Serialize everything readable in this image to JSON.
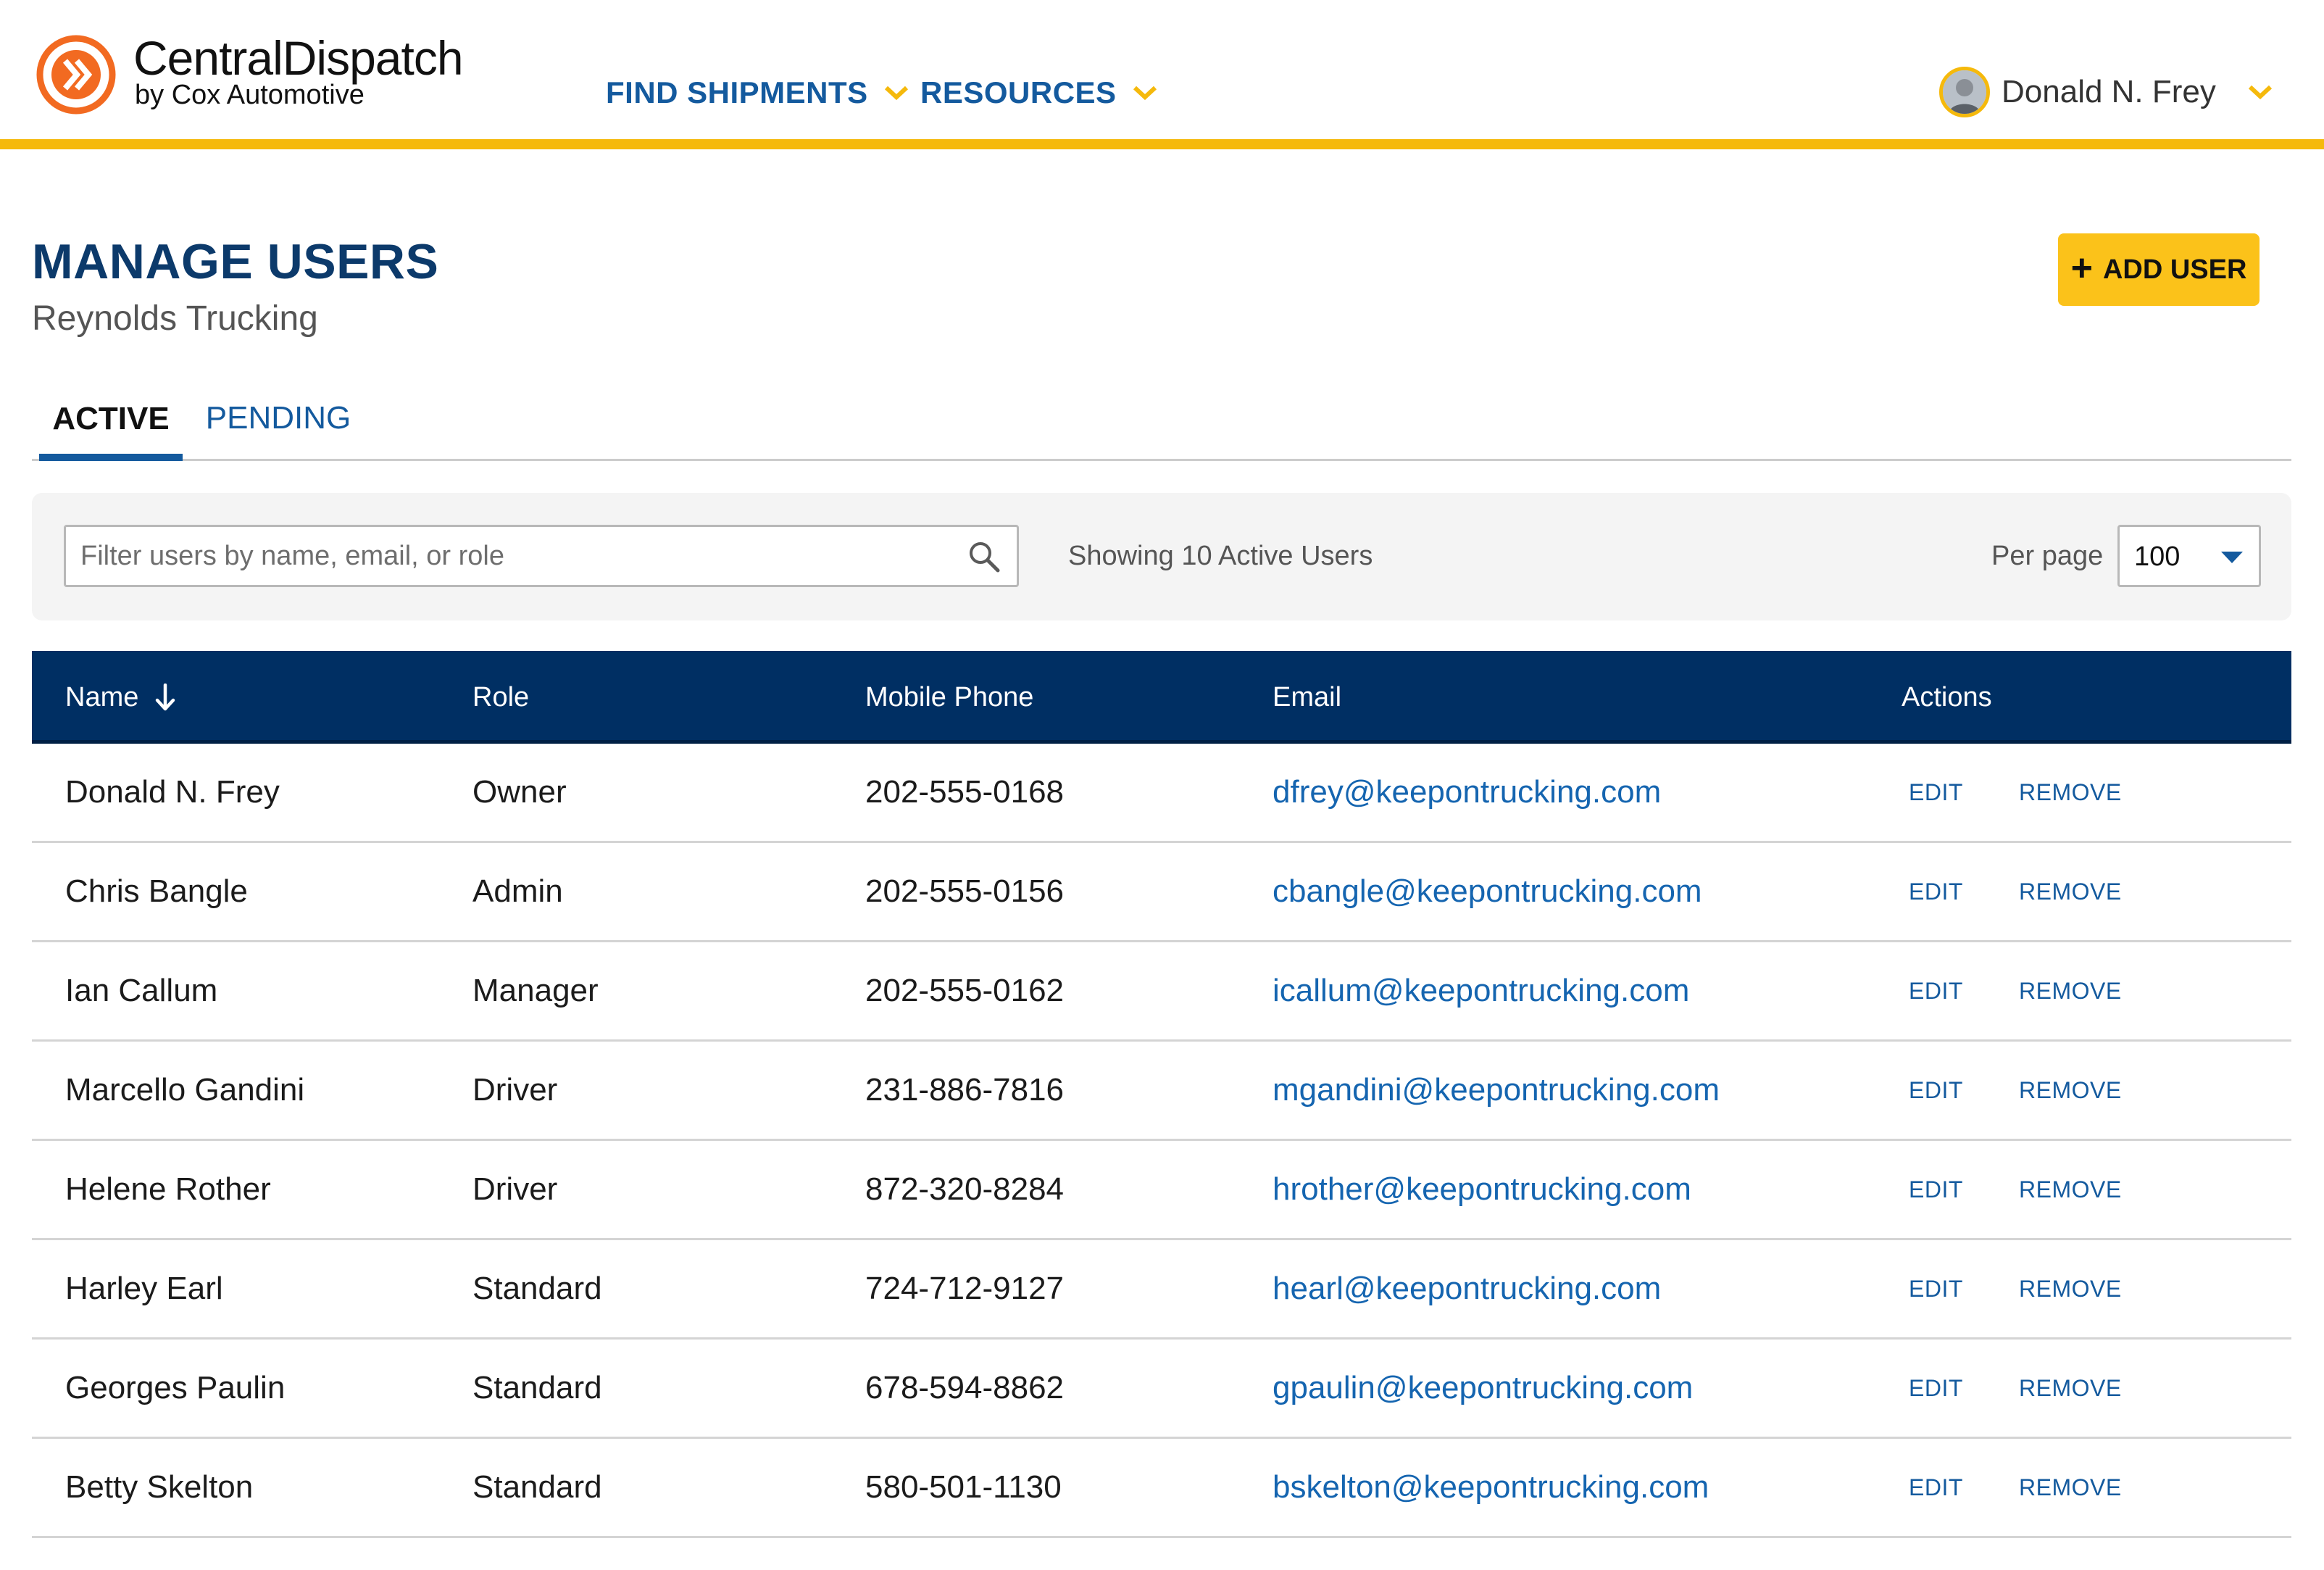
{
  "brand": {
    "title": "CentralDispatch",
    "subtitle": "by Cox Automotive",
    "accent": "#f5b90c",
    "primary": "#002f63",
    "link": "#1565b0"
  },
  "nav": {
    "items": [
      {
        "label": "FIND SHIPMENTS",
        "icon": "chevron-down-icon"
      },
      {
        "label": "RESOURCES",
        "icon": "chevron-down-icon"
      }
    ]
  },
  "user": {
    "name": "Donald N. Frey",
    "icon": "chevron-down-icon"
  },
  "header": {
    "title": "MANAGE USERS",
    "company": "Reynolds Trucking",
    "add_button": "ADD USER"
  },
  "tabs": [
    {
      "label": "ACTIVE",
      "selected": true
    },
    {
      "label": "PENDING",
      "selected": false
    }
  ],
  "filter": {
    "placeholder": "Filter users by name, email, or role",
    "value": "",
    "showing_text": "Showing 10 Active Users",
    "per_page_label": "Per page",
    "per_page_value": "100"
  },
  "table": {
    "columns": [
      "Name",
      "Role",
      "Mobile Phone",
      "Email",
      "Actions"
    ],
    "sort_column": "Name",
    "sort_direction": "descending",
    "action_labels": {
      "edit": "EDIT",
      "remove": "REMOVE"
    },
    "rows": [
      {
        "name": "Donald N. Frey",
        "role": "Owner",
        "phone": "202-555-0168",
        "email": "dfrey@keepontrucking.com"
      },
      {
        "name": "Chris Bangle",
        "role": "Admin",
        "phone": "202-555-0156",
        "email": "cbangle@keepontrucking.com"
      },
      {
        "name": "Ian Callum",
        "role": "Manager",
        "phone": "202-555-0162",
        "email": "icallum@keepontrucking.com"
      },
      {
        "name": "Marcello Gandini",
        "role": "Driver",
        "phone": "231-886-7816",
        "email": "mgandini@keepontrucking.com"
      },
      {
        "name": "Helene Rother",
        "role": "Driver",
        "phone": "872-320-8284",
        "email": "hrother@keepontrucking.com"
      },
      {
        "name": "Harley Earl",
        "role": "Standard",
        "phone": "724-712-9127",
        "email": "hearl@keepontrucking.com"
      },
      {
        "name": "Georges Paulin",
        "role": "Standard",
        "phone": "678-594-8862",
        "email": "gpaulin@keepontrucking.com"
      },
      {
        "name": "Betty Skelton",
        "role": "Standard",
        "phone": "580-501-1130",
        "email": "bskelton@keepontrucking.com"
      }
    ]
  }
}
